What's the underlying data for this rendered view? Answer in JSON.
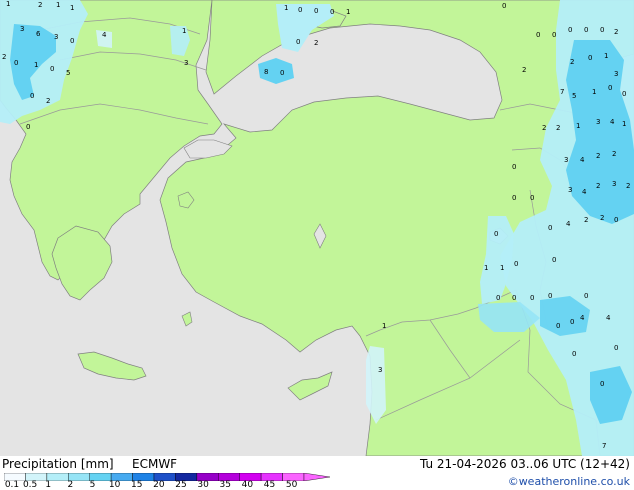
{
  "header": {
    "title": "Precipitation [mm]",
    "model": "ECMWF",
    "valid_time": "Tu 21-04-2026 03..06 UTC (12+42)",
    "credit": "©weatheronline.co.uk"
  },
  "colors": {
    "sea": "#e4e4e4",
    "land": "#c2f599",
    "coast": "#808080",
    "border": "#999999"
  },
  "legend": {
    "bins": [
      {
        "label": "0.1",
        "color": "#f5fbff"
      },
      {
        "label": "0.5",
        "color": "#d2f4fa"
      },
      {
        "label": "1",
        "color": "#b4eef8"
      },
      {
        "label": "2",
        "color": "#96e4f6"
      },
      {
        "label": "5",
        "color": "#64d2f2"
      },
      {
        "label": "10",
        "color": "#46aaf0"
      },
      {
        "label": "15",
        "color": "#1e82e6"
      },
      {
        "label": "20",
        "color": "#1e50c8"
      },
      {
        "label": "25",
        "color": "#1428a0"
      },
      {
        "label": "30",
        "color": "#9600c8"
      },
      {
        "label": "35",
        "color": "#b400dc"
      },
      {
        "label": "40",
        "color": "#d200f0"
      },
      {
        "label": "45",
        "color": "#e632ff"
      },
      {
        "label": "50",
        "color": "#fa64ff"
      }
    ]
  },
  "values": [
    "1",
    "2",
    "1",
    "3",
    "6",
    "3",
    "1",
    "2",
    "0",
    "1",
    "0",
    "5",
    "0",
    "2",
    "0",
    "0",
    "1",
    "4",
    "3",
    "1",
    "0",
    "0",
    "0",
    "1",
    "0",
    "2",
    "8",
    "0",
    "0",
    "0",
    "0",
    "0",
    "0",
    "0",
    "2",
    "2",
    "2",
    "0",
    "1",
    "3",
    "7",
    "5",
    "1",
    "0",
    "0",
    "2",
    "2",
    "1",
    "3",
    "4",
    "1",
    "3",
    "4",
    "2",
    "2",
    "3",
    "4",
    "2",
    "3",
    "2",
    "0",
    "0",
    "0",
    "0",
    "4",
    "2",
    "2",
    "0",
    "0",
    "1",
    "1",
    "0",
    "0",
    "0",
    "0",
    "0",
    "0",
    "0",
    "0",
    "4",
    "4",
    "0",
    "0",
    "0",
    "1",
    "3",
    "0",
    "7"
  ]
}
